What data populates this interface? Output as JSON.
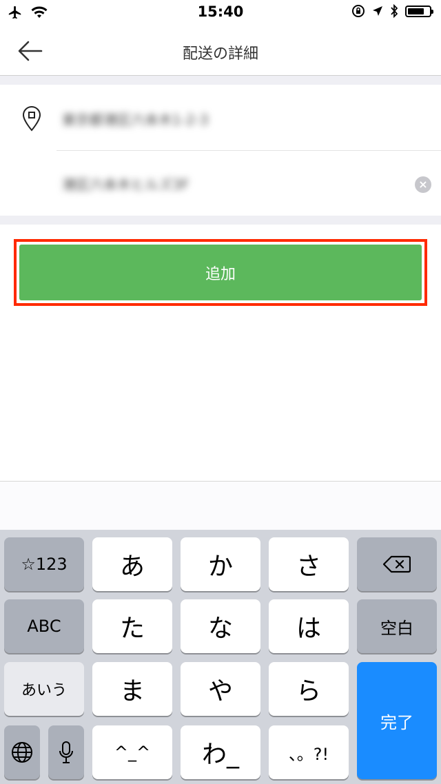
{
  "status_bar": {
    "time": "15:40",
    "icons": [
      "airplane-icon",
      "wifi-icon",
      "orientation-lock-icon",
      "location-icon",
      "bluetooth-icon",
      "battery-icon"
    ],
    "battery_level": 0.75
  },
  "header": {
    "title": "配送の詳細",
    "back_icon": "back-arrow-icon"
  },
  "form": {
    "pin_icon": "location-pin-icon",
    "address_line1": "東京都港区六本木1-2-3",
    "address_line2": "港区六本木ヒルズ3F",
    "clear_icon": "clear-icon"
  },
  "add_button": {
    "label": "追加",
    "color": "#5cb85c",
    "highlight_color": "#ff2a00"
  },
  "keyboard": {
    "row1": [
      "☆123",
      "あ",
      "か",
      "さ"
    ],
    "delete_icon": "backspace-icon",
    "row2": [
      "ABC",
      "た",
      "な",
      "は",
      "空白"
    ],
    "row3": [
      "あいう",
      "ま",
      "や",
      "ら"
    ],
    "done": "完了",
    "row4_icons": [
      "globe-icon",
      "microphone-icon"
    ],
    "row4": [
      "^_^",
      "わ_",
      "、。?!"
    ],
    "done_color": "#1a8cff"
  }
}
